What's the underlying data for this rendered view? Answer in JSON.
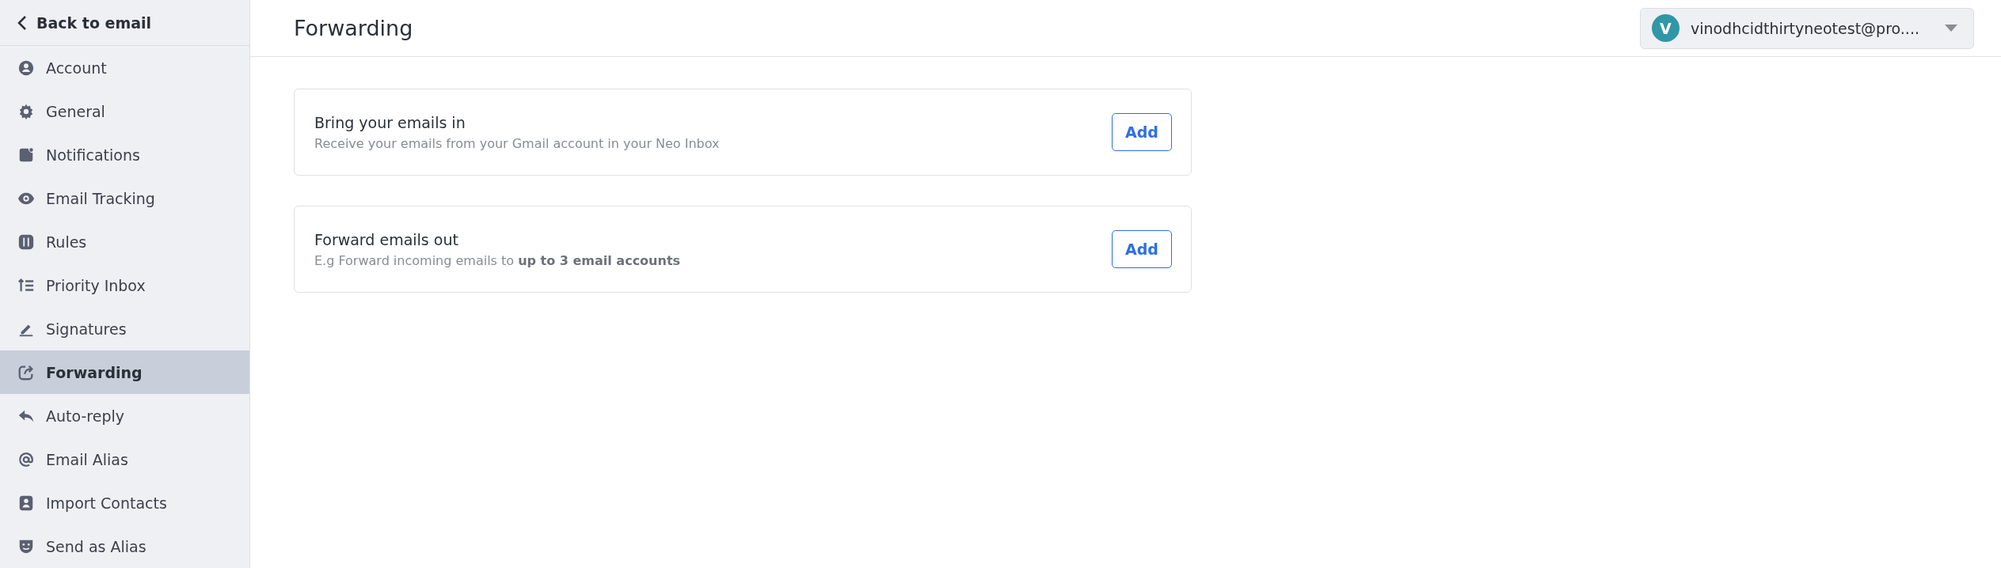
{
  "sidebar": {
    "back_link": "Back to email",
    "items": [
      {
        "label": "Account",
        "selected": false
      },
      {
        "label": "General",
        "selected": false
      },
      {
        "label": "Notifications",
        "selected": false
      },
      {
        "label": "Email Tracking",
        "selected": false
      },
      {
        "label": "Rules",
        "selected": false
      },
      {
        "label": "Priority Inbox",
        "selected": false
      },
      {
        "label": "Signatures",
        "selected": false
      },
      {
        "label": "Forwarding",
        "selected": true
      },
      {
        "label": "Auto-reply",
        "selected": false
      },
      {
        "label": "Email Alias",
        "selected": false
      },
      {
        "label": "Import Contacts",
        "selected": false
      },
      {
        "label": "Send as Alias",
        "selected": false
      }
    ]
  },
  "header": {
    "title": "Forwarding",
    "account": {
      "initial": "V",
      "email": "vinodhcidthirtyneotest@pro...."
    }
  },
  "cards": [
    {
      "title": "Bring your emails in",
      "description": "Receive your emails from your Gmail account in your Neo Inbox",
      "button": "Add"
    },
    {
      "title": "Forward emails out",
      "description": "E.g Forward incoming emails to **up to 3 email accounts**",
      "button": "Add"
    }
  ]
}
